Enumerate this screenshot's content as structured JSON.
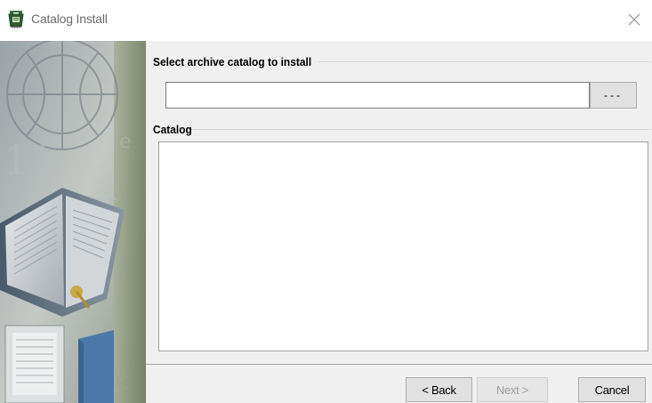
{
  "window": {
    "title": "Catalog Install",
    "close_glyph": "✕"
  },
  "archive_group": {
    "title": "Select archive catalog to install",
    "input_value": "",
    "browse_label": "---"
  },
  "catalog_group": {
    "title": "Catalog",
    "items": []
  },
  "buttons": {
    "back_label": "< Back",
    "next_label": "Next >",
    "cancel_label": "Cancel"
  },
  "icons": {
    "app": "catalog-install-app-icon",
    "close": "close-icon"
  },
  "colors": {
    "window_bg": "#f0f0f0",
    "title_bar_bg": "#ffffff",
    "title_text": "#6b6b6b",
    "button_face": "#e1e1e1",
    "disabled_text": "#a0a0a0"
  }
}
